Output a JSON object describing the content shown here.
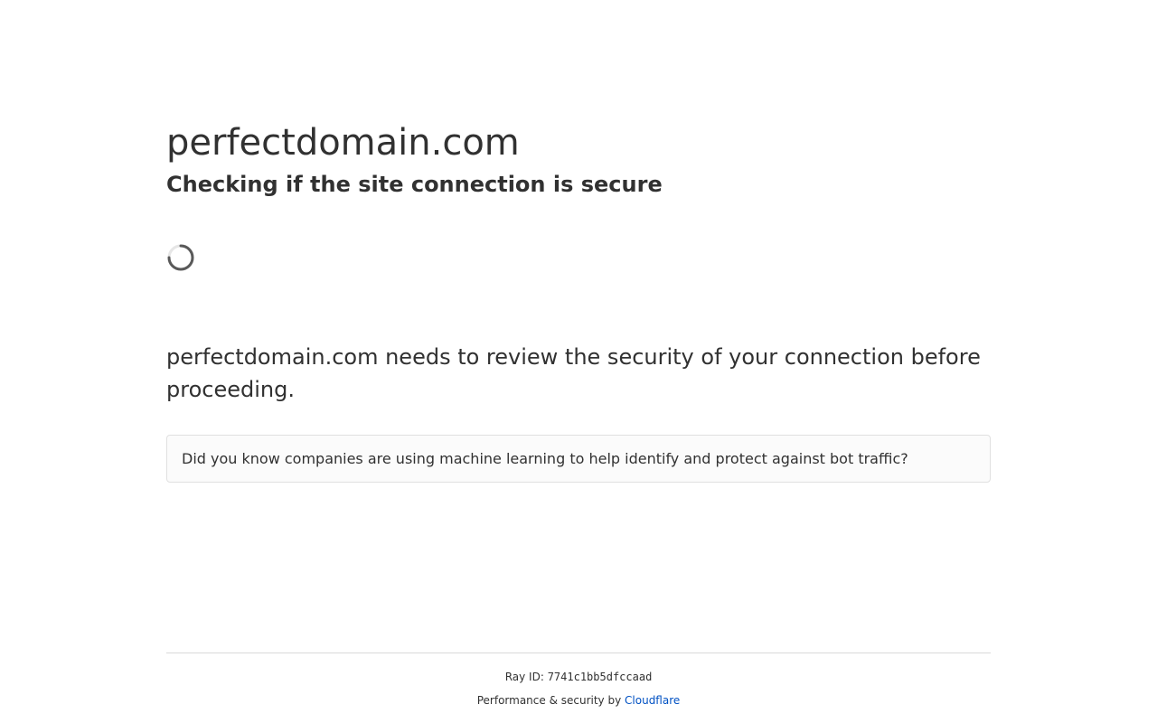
{
  "site": {
    "domain": "perfectdomain.com",
    "status_heading": "Checking if the site connection is secure"
  },
  "spinner": {
    "icon": "loading-spinner-icon"
  },
  "message": {
    "text": "perfectdomain.com needs to review the security of your connection before proceeding."
  },
  "tip": {
    "text": "Did you know companies are using machine learning to help identify and protect against bot traffic?"
  },
  "footer": {
    "ray_label": "Ray ID:",
    "ray_id": "7741c1bb5dfccaad",
    "perf_label": "Performance & security by",
    "provider_link": "Cloudflare"
  },
  "colors": {
    "text": "#313131",
    "link": "#0051c3",
    "divider": "#d9d9d9",
    "box_border": "#e0e0e0",
    "spinner_track": "#595959"
  }
}
